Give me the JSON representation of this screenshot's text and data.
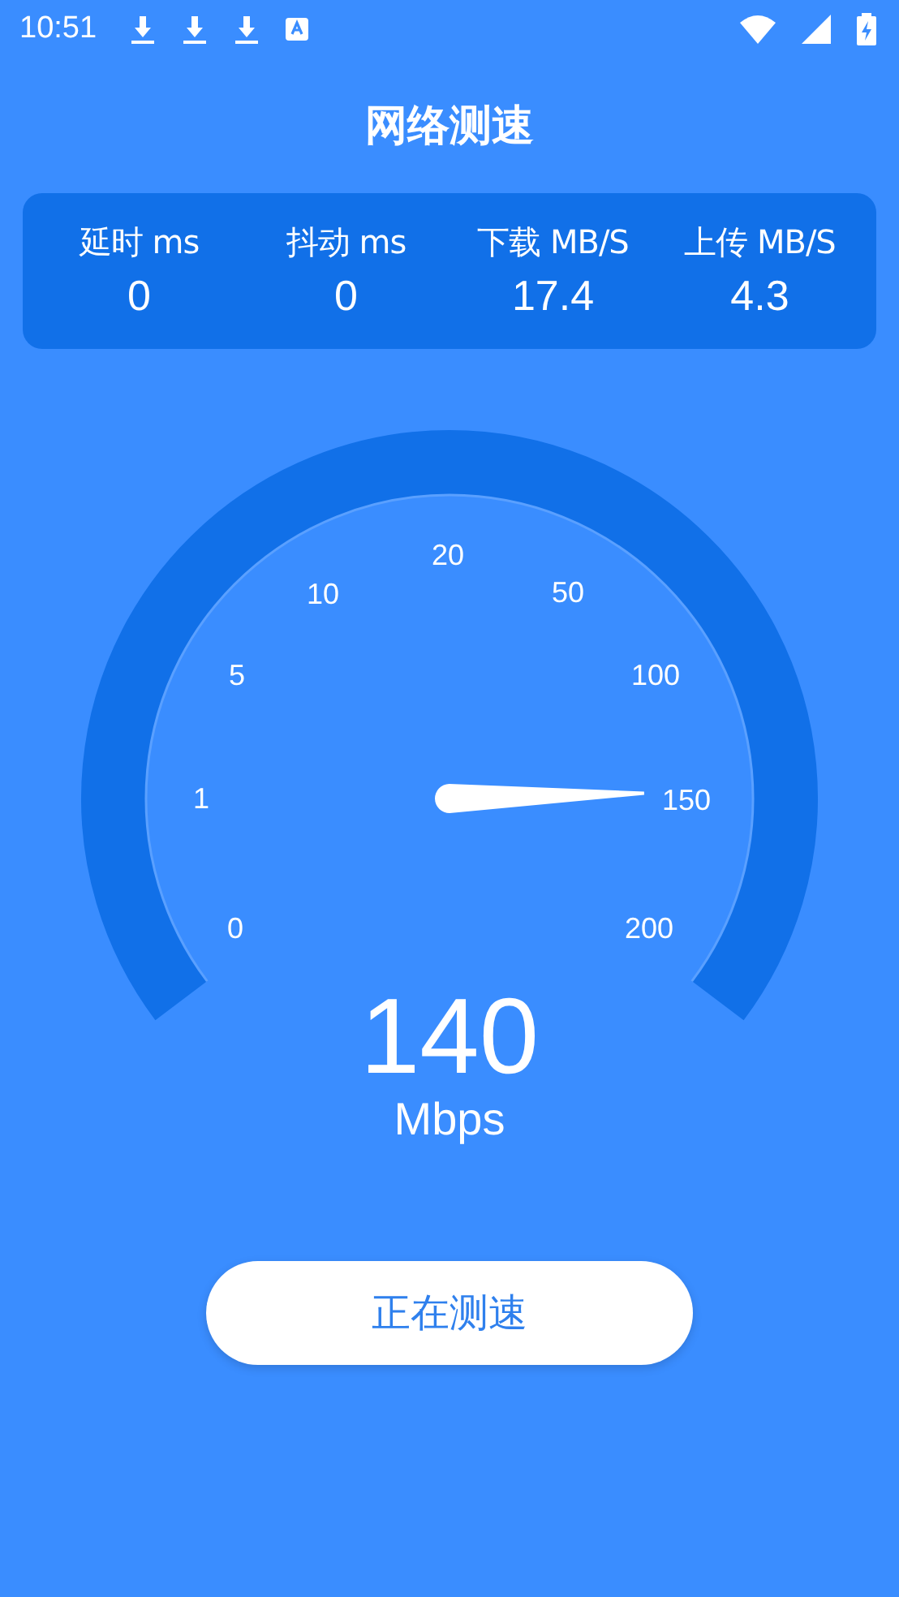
{
  "status_bar": {
    "time": "10:51"
  },
  "title": "网络测速",
  "stats": [
    {
      "label": "延时 ms",
      "value": "0"
    },
    {
      "label": "抖动 ms",
      "value": "0"
    },
    {
      "label": "下载 MB/S",
      "value": "17.4"
    },
    {
      "label": "上传 MB/S",
      "value": "4.3"
    }
  ],
  "gauge": {
    "scale": [
      "0",
      "1",
      "5",
      "10",
      "20",
      "50",
      "100",
      "150",
      "200"
    ],
    "reading": "140",
    "unit": "Mbps"
  },
  "button": "正在测速"
}
